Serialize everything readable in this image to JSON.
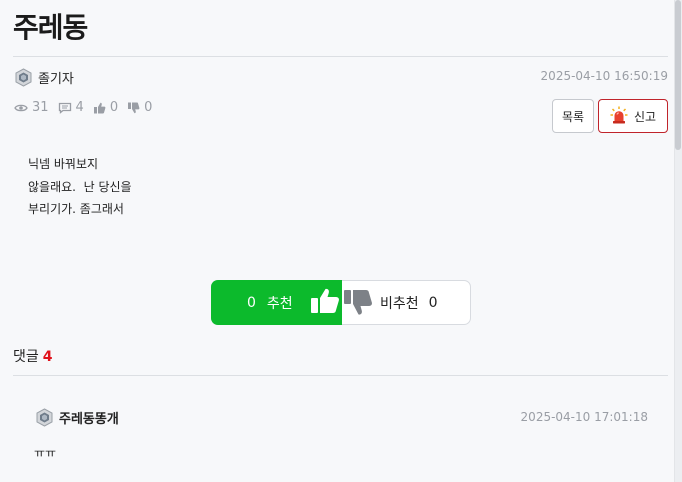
{
  "post": {
    "title": "주레동",
    "author": "졸기자",
    "date": "2025-04-10 16:50:19",
    "views": "31",
    "comments": "4",
    "likes": "0",
    "dislikes": "0",
    "content_lines": [
      "닉넴 바꿔보지",
      "않을래요.  난 당신을",
      "부리기가. 좀그래서"
    ]
  },
  "buttons": {
    "list_label": "목록",
    "report_label": "신고"
  },
  "vote": {
    "up_count": "0",
    "up_label": "추천",
    "down_label": "비추천",
    "down_count": "0"
  },
  "comments": {
    "heading": "댓글",
    "count": "4",
    "items": [
      {
        "author": "주레동똥개",
        "date": "2025-04-10 17:01:18",
        "text": "ㅠㅠ"
      }
    ]
  },
  "colors": {
    "accent_green": "#0cba2c",
    "report_red": "#c0242b",
    "count_red": "#e0121b"
  }
}
